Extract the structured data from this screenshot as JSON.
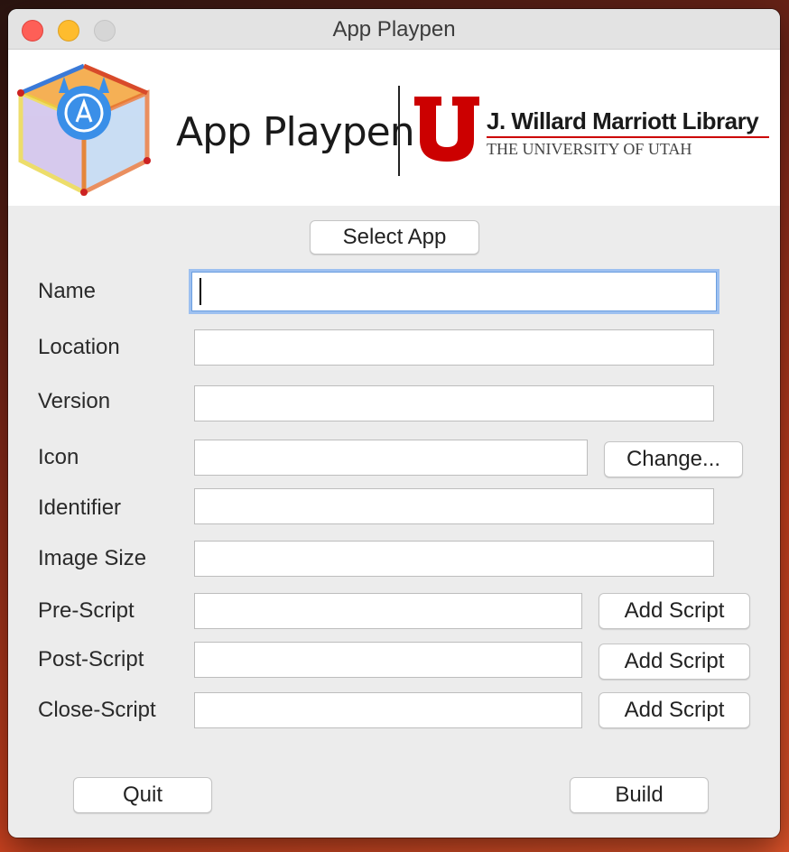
{
  "window": {
    "title": "App Playpen"
  },
  "banner": {
    "app_name": "App Playpen",
    "library_name": "J. Willard Marriott Library",
    "university_name": "THE UNIVERSITY OF UTAH"
  },
  "buttons": {
    "select_app": "Select App",
    "change_icon": "Change...",
    "add_pre_script": "Add Script",
    "add_post_script": "Add Script",
    "add_close_script": "Add Script",
    "quit": "Quit",
    "build": "Build"
  },
  "fields": {
    "name": {
      "label": "Name",
      "value": ""
    },
    "location": {
      "label": "Location",
      "value": ""
    },
    "version": {
      "label": "Version",
      "value": ""
    },
    "icon": {
      "label": "Icon",
      "value": ""
    },
    "identifier": {
      "label": "Identifier",
      "value": ""
    },
    "image_size": {
      "label": "Image Size",
      "value": ""
    },
    "pre_script": {
      "label": "Pre-Script",
      "value": ""
    },
    "post_script": {
      "label": "Post-Script",
      "value": ""
    },
    "close_script": {
      "label": "Close-Script",
      "value": ""
    }
  },
  "colors": {
    "close": "#fe5f57",
    "minimize": "#febc2e",
    "utah_red": "#cc0000",
    "focus_ring": "#9dc0f0"
  },
  "icons": [
    "playpen-logo-icon",
    "university-u-logo-icon"
  ]
}
